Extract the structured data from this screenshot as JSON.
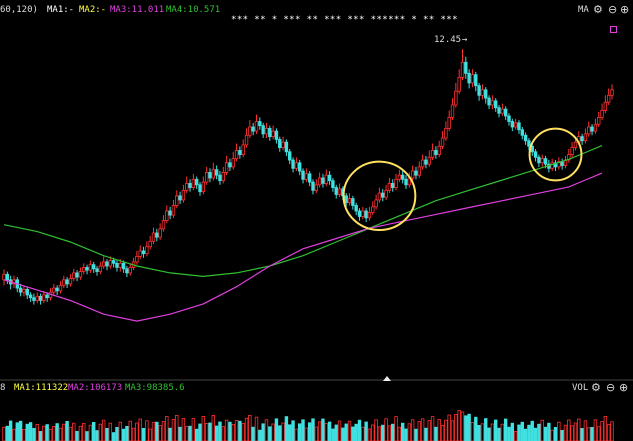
{
  "header": {
    "params": "60,120)",
    "ma1": "MA1:-",
    "ma2": "MA2:-",
    "ma3": "MA3:11.011",
    "ma4": "MA4:10.571",
    "indicator": "MA",
    "stars": "*** ** * *** ** *** *** ****** * ** ***"
  },
  "volume_header": {
    "prefix": "8",
    "ma1": "MA1:111322",
    "ma2": "MA2:106173",
    "ma3": "MA3:98385.6",
    "indicator": "VOL"
  },
  "colors": {
    "up": "#ff3030",
    "down": "#40e0e0",
    "ma3": "#e040e0",
    "ma4": "#30c030",
    "ma1_label": "#ffffff",
    "ma2_label": "#ffff40",
    "circle": "#ffe060"
  },
  "icons": [
    "gear-icon",
    "minus-icon",
    "plus-icon",
    "expand-up-icon"
  ],
  "chart_data": {
    "type": "candlestick",
    "peak_label": "12.45",
    "price_range": [
      8.4,
      12.7
    ],
    "ma3": [
      [
        0,
        9.1
      ],
      [
        10,
        8.95
      ],
      [
        20,
        8.8
      ],
      [
        30,
        8.6
      ],
      [
        40,
        8.5
      ],
      [
        50,
        8.6
      ],
      [
        60,
        8.75
      ],
      [
        70,
        9.0
      ],
      [
        80,
        9.3
      ],
      [
        90,
        9.55
      ],
      [
        100,
        9.7
      ],
      [
        110,
        9.85
      ],
      [
        120,
        9.95
      ],
      [
        130,
        10.05
      ],
      [
        140,
        10.15
      ],
      [
        150,
        10.25
      ],
      [
        160,
        10.35
      ],
      [
        170,
        10.45
      ],
      [
        175,
        10.55
      ],
      [
        180,
        10.65
      ]
    ],
    "ma4": [
      [
        0,
        9.9
      ],
      [
        10,
        9.8
      ],
      [
        20,
        9.65
      ],
      [
        30,
        9.45
      ],
      [
        40,
        9.3
      ],
      [
        50,
        9.2
      ],
      [
        60,
        9.15
      ],
      [
        70,
        9.2
      ],
      [
        80,
        9.3
      ],
      [
        90,
        9.45
      ],
      [
        100,
        9.65
      ],
      [
        110,
        9.85
      ],
      [
        120,
        10.05
      ],
      [
        130,
        10.25
      ],
      [
        140,
        10.4
      ],
      [
        150,
        10.55
      ],
      [
        160,
        10.7
      ],
      [
        170,
        10.85
      ],
      [
        175,
        10.95
      ],
      [
        180,
        11.05
      ]
    ],
    "highlight_regions": [
      {
        "from": 104,
        "to": 122
      },
      {
        "from": 160,
        "to": 172
      }
    ],
    "candles": [
      [
        9.1,
        9.18,
        9.25,
        9.02
      ],
      [
        9.18,
        9.1,
        9.22,
        9.04
      ],
      [
        9.1,
        9.04,
        9.16,
        8.96
      ],
      [
        9.04,
        9.1,
        9.16,
        8.98
      ],
      [
        9.1,
        8.98,
        9.14,
        8.92
      ],
      [
        8.98,
        8.92,
        9.04,
        8.86
      ],
      [
        8.92,
        8.96,
        9.02,
        8.86
      ],
      [
        8.96,
        8.88,
        9.0,
        8.82
      ],
      [
        8.88,
        8.84,
        8.92,
        8.78
      ],
      [
        8.84,
        8.8,
        8.9,
        8.74
      ],
      [
        8.8,
        8.86,
        8.92,
        8.76
      ],
      [
        8.86,
        8.8,
        8.9,
        8.74
      ],
      [
        8.8,
        8.88,
        8.94,
        8.76
      ],
      [
        8.88,
        8.84,
        8.92,
        8.78
      ],
      [
        8.84,
        8.92,
        8.98,
        8.8
      ],
      [
        8.92,
        8.98,
        9.04,
        8.88
      ],
      [
        8.98,
        8.94,
        9.02,
        8.88
      ],
      [
        8.94,
        9.02,
        9.08,
        8.9
      ],
      [
        9.02,
        9.1,
        9.16,
        8.98
      ],
      [
        9.1,
        9.04,
        9.14,
        8.98
      ],
      [
        9.04,
        9.12,
        9.18,
        9.0
      ],
      [
        9.12,
        9.2,
        9.26,
        9.08
      ],
      [
        9.2,
        9.14,
        9.24,
        9.08
      ],
      [
        9.14,
        9.22,
        9.28,
        9.1
      ],
      [
        9.22,
        9.28,
        9.34,
        9.18
      ],
      [
        9.28,
        9.24,
        9.32,
        9.18
      ],
      [
        9.24,
        9.32,
        9.38,
        9.2
      ],
      [
        9.32,
        9.26,
        9.36,
        9.2
      ],
      [
        9.26,
        9.22,
        9.3,
        9.16
      ],
      [
        9.22,
        9.3,
        9.36,
        9.18
      ],
      [
        9.3,
        9.36,
        9.44,
        9.26
      ],
      [
        9.36,
        9.3,
        9.4,
        9.24
      ],
      [
        9.3,
        9.38,
        9.44,
        9.26
      ],
      [
        9.38,
        9.34,
        9.42,
        9.28
      ],
      [
        9.34,
        9.28,
        9.38,
        9.22
      ],
      [
        9.28,
        9.34,
        9.4,
        9.22
      ],
      [
        9.34,
        9.26,
        9.38,
        9.2
      ],
      [
        9.26,
        9.2,
        9.3,
        9.14
      ],
      [
        9.2,
        9.28,
        9.34,
        9.16
      ],
      [
        9.28,
        9.36,
        9.42,
        9.24
      ],
      [
        9.36,
        9.44,
        9.52,
        9.32
      ],
      [
        9.44,
        9.52,
        9.6,
        9.4
      ],
      [
        9.52,
        9.48,
        9.58,
        9.42
      ],
      [
        9.48,
        9.58,
        9.66,
        9.44
      ],
      [
        9.58,
        9.66,
        9.74,
        9.54
      ],
      [
        9.66,
        9.78,
        9.86,
        9.62
      ],
      [
        9.78,
        9.72,
        9.84,
        9.66
      ],
      [
        9.72,
        9.84,
        9.92,
        9.68
      ],
      [
        9.84,
        9.96,
        10.04,
        9.8
      ],
      [
        9.96,
        10.1,
        10.18,
        9.92
      ],
      [
        10.1,
        10.04,
        10.16,
        9.98
      ],
      [
        10.04,
        10.18,
        10.26,
        10.0
      ],
      [
        10.18,
        10.32,
        10.4,
        10.14
      ],
      [
        10.32,
        10.26,
        10.38,
        10.2
      ],
      [
        10.26,
        10.4,
        10.48,
        10.22
      ],
      [
        10.4,
        10.5,
        10.6,
        10.36
      ],
      [
        10.5,
        10.44,
        10.56,
        10.38
      ],
      [
        10.44,
        10.56,
        10.64,
        10.4
      ],
      [
        10.56,
        10.48,
        10.6,
        10.42
      ],
      [
        10.48,
        10.38,
        10.52,
        10.32
      ],
      [
        10.38,
        10.52,
        10.6,
        10.34
      ],
      [
        10.52,
        10.66,
        10.74,
        10.48
      ],
      [
        10.66,
        10.58,
        10.72,
        10.52
      ],
      [
        10.58,
        10.7,
        10.8,
        10.54
      ],
      [
        10.7,
        10.62,
        10.76,
        10.56
      ],
      [
        10.62,
        10.54,
        10.68,
        10.48
      ],
      [
        10.54,
        10.66,
        10.74,
        10.5
      ],
      [
        10.66,
        10.8,
        10.9,
        10.62
      ],
      [
        10.8,
        10.74,
        10.86,
        10.68
      ],
      [
        10.74,
        10.86,
        10.96,
        10.7
      ],
      [
        10.86,
        10.98,
        11.08,
        10.82
      ],
      [
        10.98,
        10.92,
        11.04,
        10.86
      ],
      [
        10.92,
        11.06,
        11.14,
        10.88
      ],
      [
        11.06,
        11.2,
        11.3,
        11.02
      ],
      [
        11.2,
        11.32,
        11.42,
        11.16
      ],
      [
        11.32,
        11.26,
        11.38,
        11.2
      ],
      [
        11.26,
        11.4,
        11.5,
        11.22
      ],
      [
        11.4,
        11.34,
        11.46,
        11.28
      ],
      [
        11.34,
        11.22,
        11.38,
        11.16
      ],
      [
        11.22,
        11.3,
        11.38,
        11.16
      ],
      [
        11.3,
        11.18,
        11.34,
        11.12
      ],
      [
        11.18,
        11.26,
        11.34,
        11.14
      ],
      [
        11.26,
        11.14,
        11.3,
        11.08
      ],
      [
        11.14,
        11.02,
        11.18,
        10.96
      ],
      [
        11.02,
        11.1,
        11.18,
        10.98
      ],
      [
        11.1,
        10.96,
        11.14,
        10.9
      ],
      [
        10.96,
        10.84,
        11.0,
        10.78
      ],
      [
        10.84,
        10.72,
        10.88,
        10.66
      ],
      [
        10.72,
        10.8,
        10.88,
        10.68
      ],
      [
        10.8,
        10.68,
        10.84,
        10.62
      ],
      [
        10.68,
        10.56,
        10.72,
        10.5
      ],
      [
        10.56,
        10.64,
        10.72,
        10.52
      ],
      [
        10.64,
        10.52,
        10.68,
        10.46
      ],
      [
        10.52,
        10.4,
        10.56,
        10.34
      ],
      [
        10.4,
        10.48,
        10.56,
        10.36
      ],
      [
        10.48,
        10.58,
        10.66,
        10.44
      ],
      [
        10.58,
        10.5,
        10.64,
        10.44
      ],
      [
        10.5,
        10.62,
        10.7,
        10.46
      ],
      [
        10.62,
        10.54,
        10.68,
        10.48
      ],
      [
        10.54,
        10.44,
        10.58,
        10.38
      ],
      [
        10.44,
        10.34,
        10.48,
        10.28
      ],
      [
        10.34,
        10.42,
        10.5,
        10.3
      ],
      [
        10.42,
        10.32,
        10.46,
        10.26
      ],
      [
        10.32,
        10.22,
        10.36,
        10.16
      ],
      [
        10.22,
        10.28,
        10.36,
        10.18
      ],
      [
        10.28,
        10.18,
        10.32,
        10.12
      ],
      [
        10.18,
        10.1,
        10.22,
        10.04
      ],
      [
        10.1,
        10.02,
        10.14,
        9.96
      ],
      [
        10.02,
        10.1,
        10.16,
        9.98
      ],
      [
        10.1,
        10.0,
        10.14,
        9.94
      ],
      [
        10.0,
        10.08,
        10.16,
        9.96
      ],
      [
        10.08,
        10.16,
        10.24,
        10.04
      ],
      [
        10.16,
        10.26,
        10.34,
        10.12
      ],
      [
        10.26,
        10.36,
        10.44,
        10.22
      ],
      [
        10.36,
        10.3,
        10.42,
        10.24
      ],
      [
        10.3,
        10.4,
        10.48,
        10.26
      ],
      [
        10.4,
        10.5,
        10.58,
        10.36
      ],
      [
        10.5,
        10.44,
        10.56,
        10.38
      ],
      [
        10.44,
        10.56,
        10.64,
        10.4
      ],
      [
        10.56,
        10.62,
        10.7,
        10.52
      ],
      [
        10.62,
        10.56,
        10.68,
        10.5
      ],
      [
        10.56,
        10.48,
        10.62,
        10.42
      ],
      [
        10.48,
        10.58,
        10.66,
        10.44
      ],
      [
        10.58,
        10.68,
        10.76,
        10.54
      ],
      [
        10.68,
        10.62,
        10.74,
        10.56
      ],
      [
        10.62,
        10.74,
        10.82,
        10.58
      ],
      [
        10.74,
        10.84,
        10.92,
        10.7
      ],
      [
        10.84,
        10.78,
        10.9,
        10.72
      ],
      [
        10.78,
        10.88,
        10.98,
        10.74
      ],
      [
        10.88,
        10.98,
        11.08,
        10.84
      ],
      [
        10.98,
        10.92,
        11.04,
        10.86
      ],
      [
        10.92,
        11.04,
        11.12,
        10.88
      ],
      [
        11.04,
        11.16,
        11.26,
        11.0
      ],
      [
        11.16,
        11.3,
        11.4,
        11.12
      ],
      [
        11.3,
        11.46,
        11.56,
        11.26
      ],
      [
        11.46,
        11.64,
        11.74,
        11.42
      ],
      [
        11.64,
        11.84,
        11.96,
        11.6
      ],
      [
        11.84,
        12.04,
        12.16,
        11.8
      ],
      [
        12.04,
        12.26,
        12.45,
        12.0
      ],
      [
        12.26,
        12.1,
        12.34,
        12.02
      ],
      [
        12.1,
        11.96,
        12.16,
        11.88
      ],
      [
        11.96,
        12.08,
        12.16,
        11.9
      ],
      [
        12.08,
        11.92,
        12.12,
        11.84
      ],
      [
        11.92,
        11.78,
        11.96,
        11.7
      ],
      [
        11.78,
        11.86,
        11.94,
        11.72
      ],
      [
        11.86,
        11.74,
        11.9,
        11.66
      ],
      [
        11.74,
        11.64,
        11.78,
        11.58
      ],
      [
        11.64,
        11.7,
        11.78,
        11.58
      ],
      [
        11.7,
        11.6,
        11.74,
        11.54
      ],
      [
        11.6,
        11.52,
        11.64,
        11.46
      ],
      [
        11.52,
        11.58,
        11.66,
        11.48
      ],
      [
        11.58,
        11.48,
        11.62,
        11.42
      ],
      [
        11.48,
        11.4,
        11.52,
        11.34
      ],
      [
        11.4,
        11.32,
        11.44,
        11.26
      ],
      [
        11.32,
        11.38,
        11.44,
        11.28
      ],
      [
        11.38,
        11.28,
        11.42,
        11.22
      ],
      [
        11.28,
        11.2,
        11.32,
        11.14
      ],
      [
        11.2,
        11.12,
        11.24,
        11.06
      ],
      [
        11.12,
        11.04,
        11.16,
        10.98
      ],
      [
        11.04,
        10.96,
        11.08,
        10.9
      ],
      [
        10.96,
        10.88,
        11.0,
        10.82
      ],
      [
        10.88,
        10.8,
        10.92,
        10.74
      ],
      [
        10.8,
        10.86,
        10.92,
        10.74
      ],
      [
        10.86,
        10.78,
        10.9,
        10.72
      ],
      [
        10.78,
        10.72,
        10.84,
        10.66
      ],
      [
        10.72,
        10.8,
        10.86,
        10.68
      ],
      [
        10.8,
        10.74,
        10.84,
        10.68
      ],
      [
        10.74,
        10.82,
        10.88,
        10.7
      ],
      [
        10.82,
        10.76,
        10.86,
        10.7
      ],
      [
        10.76,
        10.84,
        10.9,
        10.72
      ],
      [
        10.84,
        10.92,
        11.0,
        10.8
      ],
      [
        10.92,
        11.02,
        11.1,
        10.88
      ],
      [
        11.02,
        11.1,
        11.18,
        10.98
      ],
      [
        11.1,
        11.18,
        11.26,
        11.06
      ],
      [
        11.18,
        11.12,
        11.22,
        11.06
      ],
      [
        11.12,
        11.22,
        11.3,
        11.08
      ],
      [
        11.22,
        11.32,
        11.4,
        11.18
      ],
      [
        11.32,
        11.26,
        11.36,
        11.2
      ],
      [
        11.26,
        11.36,
        11.44,
        11.22
      ],
      [
        11.36,
        11.46,
        11.54,
        11.32
      ],
      [
        11.46,
        11.56,
        11.66,
        11.42
      ],
      [
        11.56,
        11.68,
        11.78,
        11.52
      ],
      [
        11.68,
        11.78,
        11.88,
        11.64
      ],
      [
        11.78,
        11.86,
        11.94,
        11.72
      ]
    ]
  }
}
